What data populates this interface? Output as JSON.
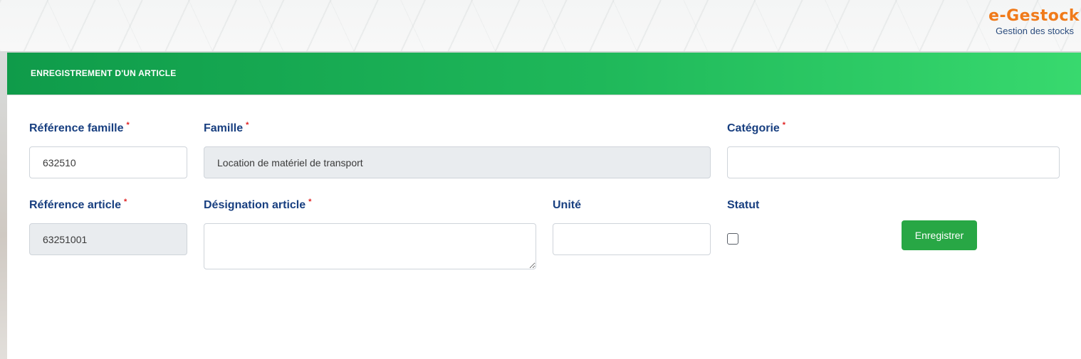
{
  "brand": {
    "name": "e-Gestock",
    "tagline": "Gestion des stocks"
  },
  "panel": {
    "title": "ENREGISTREMENT D'UN ARTICLE"
  },
  "form": {
    "required_mark": "*",
    "reference_famille": {
      "label": "Référence famille",
      "value": "632510",
      "required": true
    },
    "famille": {
      "label": "Famille",
      "value": "Location de matériel de transport",
      "required": true,
      "readonly": true
    },
    "categorie": {
      "label": "Catégorie",
      "value": "",
      "required": true
    },
    "reference_article": {
      "label": "Référence article",
      "value": "63251001",
      "required": true,
      "readonly": true
    },
    "designation_article": {
      "label": "Désignation article",
      "value": "",
      "required": true
    },
    "unite": {
      "label": "Unité",
      "value": ""
    },
    "statut": {
      "label": "Statut",
      "checked": false
    },
    "save_label": "Enregistrer"
  },
  "colors": {
    "header_start": "#0f9b4a",
    "header_end": "#38d96e",
    "label": "#183f80",
    "required": "#e02020",
    "button": "#28a745",
    "brand": "#f07a1a"
  }
}
